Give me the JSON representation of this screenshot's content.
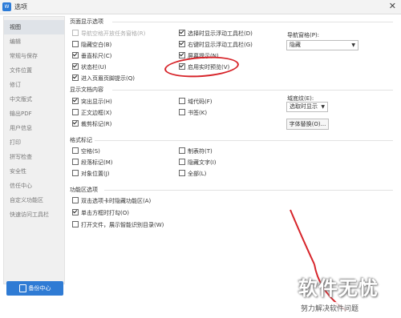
{
  "window": {
    "title": "选项",
    "app_icon_text": "W",
    "close_glyph": "✕"
  },
  "sidebar": {
    "items": [
      {
        "label": "视图",
        "active": true
      },
      {
        "label": "编辑"
      },
      {
        "label": "常规与保存"
      },
      {
        "label": "文件位置"
      },
      {
        "label": "修订"
      },
      {
        "label": "中文版式"
      },
      {
        "label": "输出PDF"
      },
      {
        "label": "用户信息"
      },
      {
        "label": "打印"
      },
      {
        "label": "拼写检查"
      },
      {
        "label": "安全性"
      },
      {
        "label": "信任中心"
      },
      {
        "label": "自定义功能区"
      },
      {
        "label": "快速访问工具栏"
      }
    ],
    "backup_label": "备份中心"
  },
  "page_display": {
    "title": "页面显示选项",
    "options": {
      "o1": {
        "label": "导航空格开放任务窗格(R)",
        "checked": false,
        "disabled": true
      },
      "o2": {
        "label": "隐藏空白(B)",
        "checked": false
      },
      "o3": {
        "label": "垂直标尺(C)",
        "checked": true
      },
      "o4": {
        "label": "状态栏(U)",
        "checked": true
      },
      "o5": {
        "label": "进入页眉页脚提示(Q)",
        "checked": true
      },
      "o6": {
        "label": "选择时显示浮动工具栏(D)",
        "checked": true
      },
      "o7": {
        "label": "右键时显示浮动工具栏(G)",
        "checked": true
      },
      "o8": {
        "label": "屏幕提示(N)",
        "checked": true
      },
      "o9": {
        "label": "启用实时预览(V)",
        "checked": true
      }
    },
    "nav_pane_label": "导航窗格(P):",
    "nav_pane_value": "隐藏"
  },
  "doc_content": {
    "title": "显示文档内容",
    "options": {
      "highlight": {
        "label": "突出显示(H)",
        "checked": true
      },
      "text_border": {
        "label": "正文边框(X)",
        "checked": false
      },
      "crop_marks": {
        "label": "裁剪标记(R)",
        "checked": true
      },
      "field_code": {
        "label": "域代码(F)",
        "checked": false
      },
      "bookmark": {
        "label": "书签(K)",
        "checked": false
      }
    },
    "field_shading_label": "域底纹(E):",
    "field_shading_value": "选取时显示",
    "font_sub_button": "字体替换(O)..."
  },
  "format_marks": {
    "title": "格式标记",
    "options": {
      "space": {
        "label": "空格(S)",
        "checked": false
      },
      "para": {
        "label": "段落标记(M)",
        "checked": false
      },
      "obj": {
        "label": "对象位置(J)",
        "checked": false
      },
      "tab": {
        "label": "制表符(T)",
        "checked": false
      },
      "hidden": {
        "label": "隐藏文字(I)",
        "checked": false
      },
      "all": {
        "label": "全部(L)",
        "checked": false
      }
    }
  },
  "func_area": {
    "title": "功能区选项",
    "options": {
      "dbl": {
        "label": "双击选项卡时隐藏功能区(A)",
        "checked": false
      },
      "single": {
        "label": "单击方框时打勾(O)",
        "checked": true
      },
      "open": {
        "label": "打开文件，展示智能识别目录(W)",
        "checked": false
      }
    }
  },
  "watermark": {
    "main": "软件无忧",
    "sub": "努力解决软件问题"
  },
  "colors": {
    "accent": "#2f7bd4",
    "annotation": "#d7242a"
  }
}
